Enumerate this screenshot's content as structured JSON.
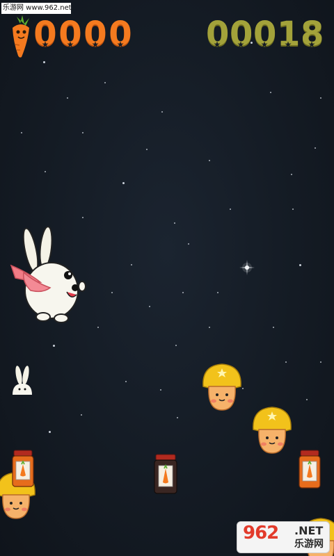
{
  "watermark_top": "乐游网 www.962.net",
  "hud": {
    "carrot_score": [
      "0",
      "0",
      "0",
      "0"
    ],
    "distance_score": [
      "0",
      "0",
      "0",
      "1",
      "8"
    ]
  },
  "logo": {
    "main": "962",
    "net": ".NET",
    "sub": "乐游网"
  },
  "colors": {
    "carrot_orange": "#f47a1f",
    "olive_score": "#a3a23a",
    "sky": "#141b24",
    "mushroom_cap": "#f2c21b"
  },
  "icons": [
    "carrot-icon",
    "bunny-player",
    "bunny-life-icon",
    "mushroom-enemy",
    "carrot-jar-pickup"
  ]
}
